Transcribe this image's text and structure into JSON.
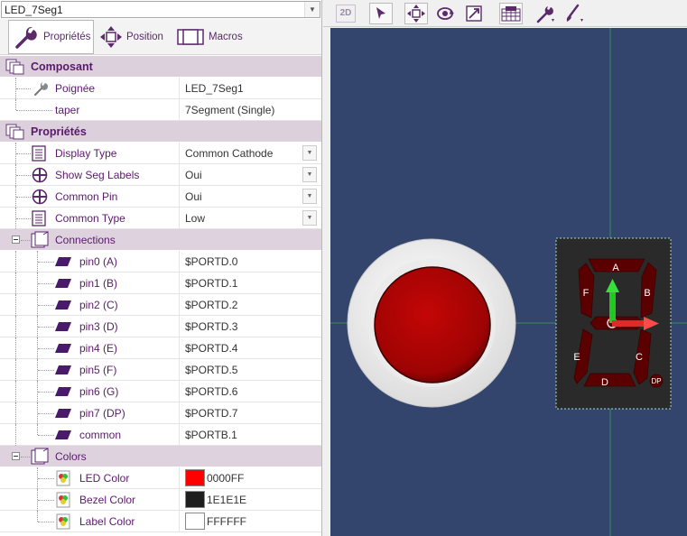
{
  "object_selector": {
    "value": "LED_7Seg1"
  },
  "tabs": [
    {
      "label": "Propriétés",
      "icon": "wrench-icon"
    },
    {
      "label": "Position",
      "icon": "move-icon"
    },
    {
      "label": "Macros",
      "icon": "macro-icon"
    }
  ],
  "toolbar": {
    "items": [
      "2d-view-icon",
      "select-arrow-icon",
      "pan-icon",
      "rotate-icon",
      "scale-icon",
      "grid-icon",
      "wrench-tool-icon",
      "paint-brush-icon"
    ],
    "label_2d": "2D"
  },
  "sections": {
    "composant": {
      "title": "Composant",
      "rows": [
        {
          "name": "Poignée",
          "value": "LED_7Seg1"
        },
        {
          "name": "taper",
          "value": "7Segment (Single)"
        }
      ]
    },
    "proprietes": {
      "title": "Propriétés",
      "rows": [
        {
          "name": "Display Type",
          "value": "Common Cathode"
        },
        {
          "name": "Show Seg Labels",
          "value": "Oui"
        },
        {
          "name": "Common Pin",
          "value": "Oui"
        },
        {
          "name": "Common Type",
          "value": "Low"
        }
      ],
      "connections": {
        "title": "Connections",
        "rows": [
          {
            "name": "pin0 (A)",
            "value": "$PORTD.0"
          },
          {
            "name": "pin1 (B)",
            "value": "$PORTD.1"
          },
          {
            "name": "pin2 (C)",
            "value": "$PORTD.2"
          },
          {
            "name": "pin3 (D)",
            "value": "$PORTD.3"
          },
          {
            "name": "pin4 (E)",
            "value": "$PORTD.4"
          },
          {
            "name": "pin5  (F)",
            "value": "$PORTD.5"
          },
          {
            "name": "pin6 (G)",
            "value": "$PORTD.6"
          },
          {
            "name": "pin7 (DP)",
            "value": "$PORTD.7"
          },
          {
            "name": "common",
            "value": "$PORTB.1"
          }
        ]
      },
      "colors": {
        "title": "Colors",
        "rows": [
          {
            "name": "LED Color",
            "value": "0000FF",
            "swatch": "#ff0000"
          },
          {
            "name": "Bezel Color",
            "value": "1E1E1E",
            "swatch": "#1e1e1e"
          },
          {
            "name": "Label Color",
            "value": "FFFFFF",
            "swatch": "#ffffff"
          }
        ]
      }
    }
  },
  "canvas": {
    "background": "#33456d",
    "segment_labels": [
      "A",
      "B",
      "C",
      "D",
      "E",
      "F",
      "DP"
    ]
  }
}
